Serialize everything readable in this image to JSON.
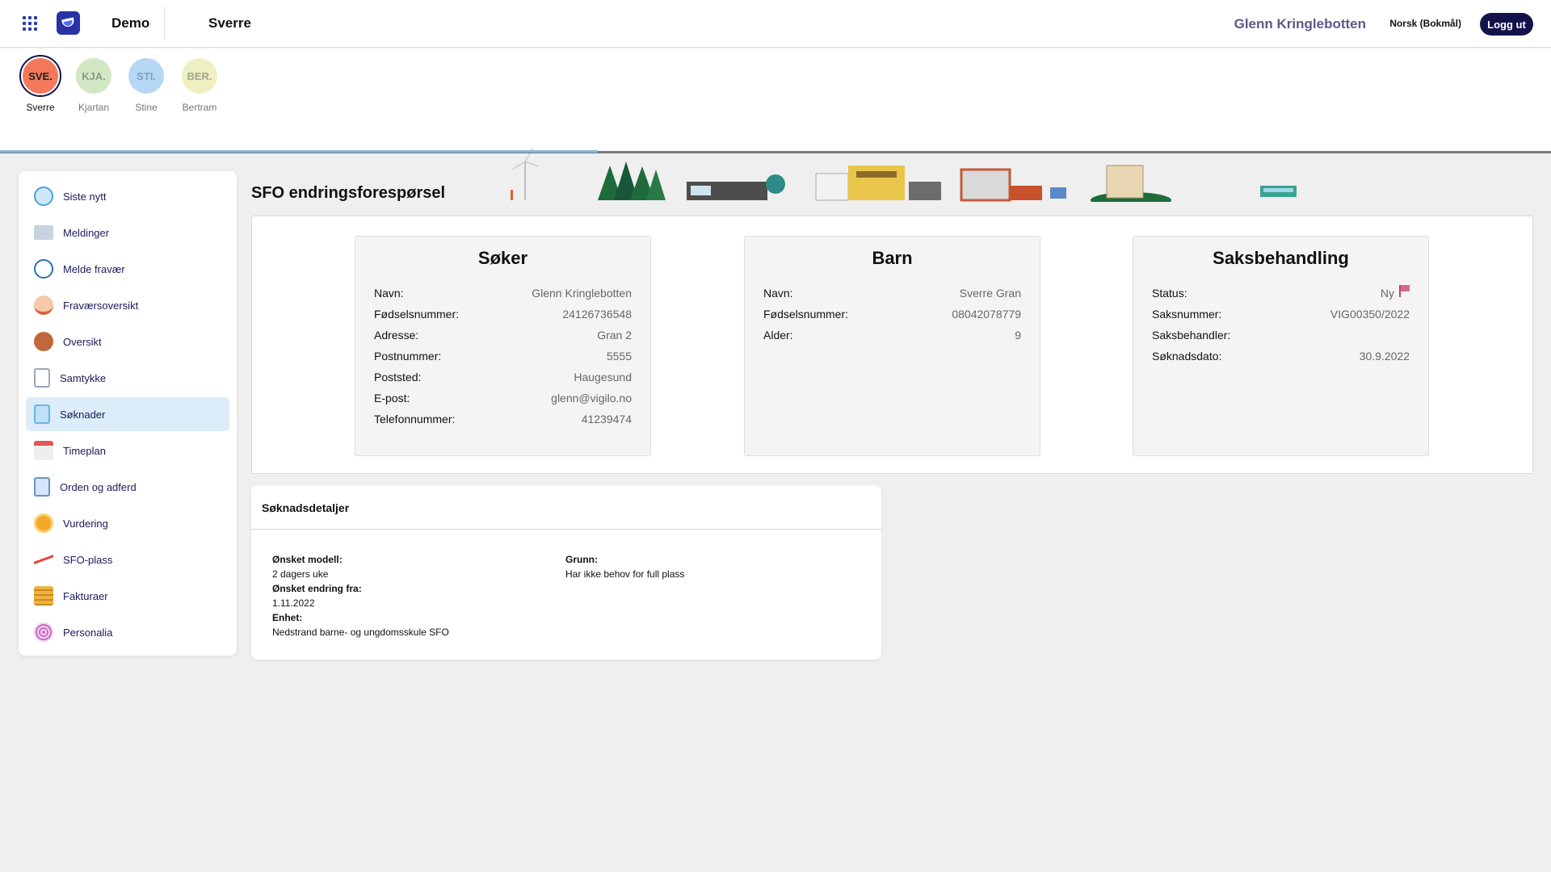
{
  "header": {
    "org": "Demo",
    "student": "Sverre",
    "user": "Glenn Kringlebotten",
    "language": "Norsk (Bokmål)",
    "logout": "Logg ut"
  },
  "children": [
    {
      "initials": "SVE.",
      "name": "Sverre",
      "color": "#f3795a",
      "selected": true
    },
    {
      "initials": "KJA.",
      "name": "Kjartan",
      "color": "#d2e7c3",
      "selected": false
    },
    {
      "initials": "STI.",
      "name": "Stine",
      "color": "#b6d8f5",
      "selected": false
    },
    {
      "initials": "BER.",
      "name": "Bertram",
      "color": "#eef0c2",
      "selected": false
    }
  ],
  "sidebar": {
    "items": [
      {
        "label": "Siste nytt",
        "icon": "news-icon",
        "color": "#4aa3df"
      },
      {
        "label": "Meldinger",
        "icon": "envelope-icon",
        "color": "#b0bfcf"
      },
      {
        "label": "Melde fravær",
        "icon": "clock-icon",
        "color": "#2a6fb8"
      },
      {
        "label": "Fraværsoversikt",
        "icon": "person-absent-icon",
        "color": "#e0603d"
      },
      {
        "label": "Oversikt",
        "icon": "person-icon",
        "color": "#c2673a"
      },
      {
        "label": "Samtykke",
        "icon": "clipboard-icon",
        "color": "#9aa7b5"
      },
      {
        "label": "Søknader",
        "icon": "search-document-icon",
        "color": "#6bb4e8"
      },
      {
        "label": "Timeplan",
        "icon": "calendar-icon",
        "color": "#e05555"
      },
      {
        "label": "Orden og adferd",
        "icon": "document-icon",
        "color": "#5e94d4"
      },
      {
        "label": "Vurdering",
        "icon": "medal-icon",
        "color": "#f3a72b"
      },
      {
        "label": "SFO-plass",
        "icon": "seesaw-icon",
        "color": "#e2493b"
      },
      {
        "label": "Fakturaer",
        "icon": "coins-icon",
        "color": "#f0b240"
      },
      {
        "label": "Personalia",
        "icon": "fingerprint-icon",
        "color": "#c86bc4"
      }
    ],
    "active_index": 6
  },
  "main": {
    "title": "SFO endringsforespørsel",
    "soker": {
      "title": "Søker",
      "rows": [
        {
          "k": "Navn:",
          "v": "Glenn Kringlebotten"
        },
        {
          "k": "Fødselsnummer:",
          "v": "24126736548"
        },
        {
          "k": "Adresse:",
          "v": "Gran 2"
        },
        {
          "k": "Postnummer:",
          "v": "5555"
        },
        {
          "k": "Poststed:",
          "v": "Haugesund"
        },
        {
          "k": "E-post:",
          "v": "glenn@vigilo.no"
        },
        {
          "k": "Telefonnummer:",
          "v": "41239474"
        }
      ]
    },
    "barn": {
      "title": "Barn",
      "rows": [
        {
          "k": "Navn:",
          "v": "Sverre Gran"
        },
        {
          "k": "Fødselsnummer:",
          "v": "08042078779"
        },
        {
          "k": "Alder:",
          "v": "9"
        }
      ]
    },
    "saksbehandling": {
      "title": "Saksbehandling",
      "rows": [
        {
          "k": "Status:",
          "v": "Ny"
        },
        {
          "k": "Saksnummer:",
          "v": "VIG00350/2022"
        },
        {
          "k": "Saksbehandler:",
          "v": ""
        },
        {
          "k": "Søknadsdato:",
          "v": "30.9.2022"
        }
      ]
    },
    "details": {
      "title": "Søknadsdetaljer",
      "onsket_modell_label": "Ønsket modell:",
      "onsket_modell": "2 dagers uke",
      "onsket_endring_label": "Ønsket endring fra:",
      "onsket_endring": "1.11.2022",
      "enhet_label": "Enhet:",
      "enhet": "Nedstrand barne- og ungdomsskule SFO",
      "grunn_label": "Grunn:",
      "grunn": "Har ikke behov for full plass"
    }
  }
}
